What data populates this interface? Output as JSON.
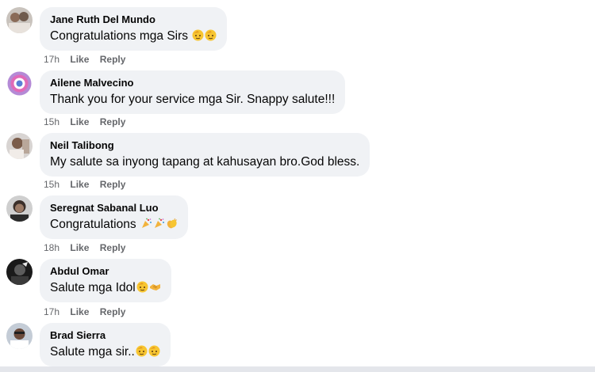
{
  "comments": [
    {
      "name": "Jane Ruth Del Mundo",
      "text": "Congratulations mga Sirs",
      "emojis": [
        "salute-face",
        "salute-face"
      ],
      "time": "17h",
      "like": "Like",
      "reply": "Reply"
    },
    {
      "name": "Ailene Malvecino",
      "text": "Thank you for your service mga Sir. Snappy salute!!!",
      "emojis": [],
      "time": "15h",
      "like": "Like",
      "reply": "Reply"
    },
    {
      "name": "Neil Talibong",
      "text": "My salute sa inyong tapang at kahusayan bro.God bless.",
      "emojis": [],
      "time": "15h",
      "like": "Like",
      "reply": "Reply"
    },
    {
      "name": "Seregnat Sabanal Luo",
      "text": "Congratulations",
      "emojis": [
        "party-popper",
        "party-popper",
        "clapping-hands"
      ],
      "time": "18h",
      "like": "Like",
      "reply": "Reply"
    },
    {
      "name": "Abdul Omar",
      "text": "Salute mga Idol",
      "emojis": [
        "salute-face",
        "handshake"
      ],
      "time": "17h",
      "like": "Like",
      "reply": "Reply"
    },
    {
      "name": "Brad Sierra",
      "text": "Salute mga sir..",
      "emojis": [
        "salute-face",
        "salute-face"
      ],
      "time": "",
      "like": "",
      "reply": ""
    }
  ],
  "colors": {
    "bubble_bg": "#f0f2f5",
    "meta_text": "#65676b",
    "emoji_yellow": "#f7c531"
  }
}
